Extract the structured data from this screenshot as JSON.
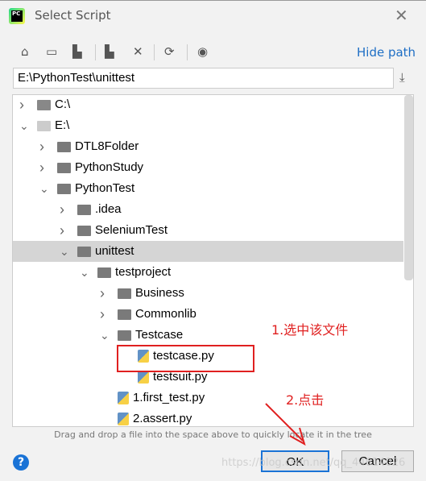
{
  "window": {
    "title": "Select Script",
    "logo_text": "PC"
  },
  "toolbar": {
    "icons": [
      "home-icon",
      "desktop-icon",
      "project-icon",
      "new-folder-icon",
      "delete-icon",
      "refresh-icon",
      "show-hidden-icon"
    ],
    "hide_path": "Hide path"
  },
  "path": {
    "value": "E:\\PythonTest\\unittest"
  },
  "tree": [
    {
      "label": "C:\\",
      "level": 0,
      "type": "drive",
      "expanded": false
    },
    {
      "label": "E:\\",
      "level": 0,
      "type": "drive",
      "expanded": true
    },
    {
      "label": "DTL8Folder",
      "level": 1,
      "type": "folder",
      "expanded": false
    },
    {
      "label": "PythonStudy",
      "level": 1,
      "type": "folder",
      "expanded": false
    },
    {
      "label": "PythonTest",
      "level": 1,
      "type": "folder",
      "expanded": true
    },
    {
      "label": ".idea",
      "level": 2,
      "type": "folder",
      "expanded": false
    },
    {
      "label": "SeleniumTest",
      "level": 2,
      "type": "folder",
      "expanded": false
    },
    {
      "label": "unittest",
      "level": 2,
      "type": "folder",
      "expanded": true,
      "selected": true
    },
    {
      "label": "testproject",
      "level": 3,
      "type": "folder",
      "expanded": true
    },
    {
      "label": "Business",
      "level": 4,
      "type": "folder",
      "expanded": false
    },
    {
      "label": "Commonlib",
      "level": 4,
      "type": "folder",
      "expanded": false
    },
    {
      "label": "Testcase",
      "level": 4,
      "type": "folder",
      "expanded": true
    },
    {
      "label": "testcase.py",
      "level": 5,
      "type": "py"
    },
    {
      "label": "testsuit.py",
      "level": 5,
      "type": "py"
    },
    {
      "label": "1.first_test.py",
      "level": 4,
      "type": "py"
    },
    {
      "label": "2.assert.py",
      "level": 4,
      "type": "py"
    }
  ],
  "hint": "Drag and drop a file into the space above to quickly locate it in the tree",
  "buttons": {
    "help": "?",
    "ok": "OK",
    "cancel": "Cancel"
  },
  "annotations": {
    "step1": "1.选中该文件",
    "step2": "2.点击",
    "color": "#e02020"
  },
  "watermark": "https://blog.csdn.net/qq_44614026"
}
